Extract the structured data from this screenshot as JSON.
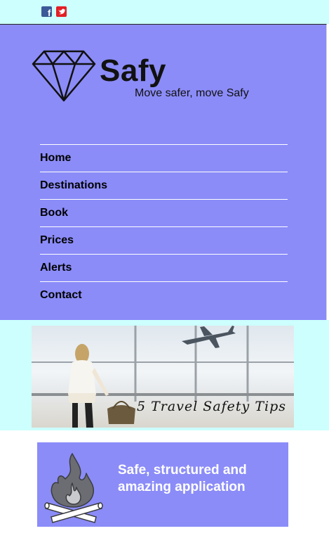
{
  "colors": {
    "accent": "#8b8cf8",
    "light_cyan": "#ccfffd",
    "facebook": "#3b5998",
    "social_red": "#e21f26"
  },
  "social": [
    {
      "icon": "facebook-icon",
      "label": "f"
    },
    {
      "icon": "twitter-icon",
      "label": "twitter"
    }
  ],
  "header": {
    "brand": "Safy",
    "tagline": "Move safer, move Safy",
    "logo_icon": "diamond-icon"
  },
  "nav": {
    "items": [
      {
        "label": "Home"
      },
      {
        "label": "Destinations"
      },
      {
        "label": "Book"
      },
      {
        "label": "Prices"
      },
      {
        "label": "Alerts"
      },
      {
        "label": "Contact"
      }
    ]
  },
  "banner": {
    "caption": "5 Travel Safety Tips",
    "image": "woman-at-airport-window-with-airplane"
  },
  "feature_card": {
    "icon": "campfire-icon",
    "text": "Safe, structured and amazing application"
  }
}
